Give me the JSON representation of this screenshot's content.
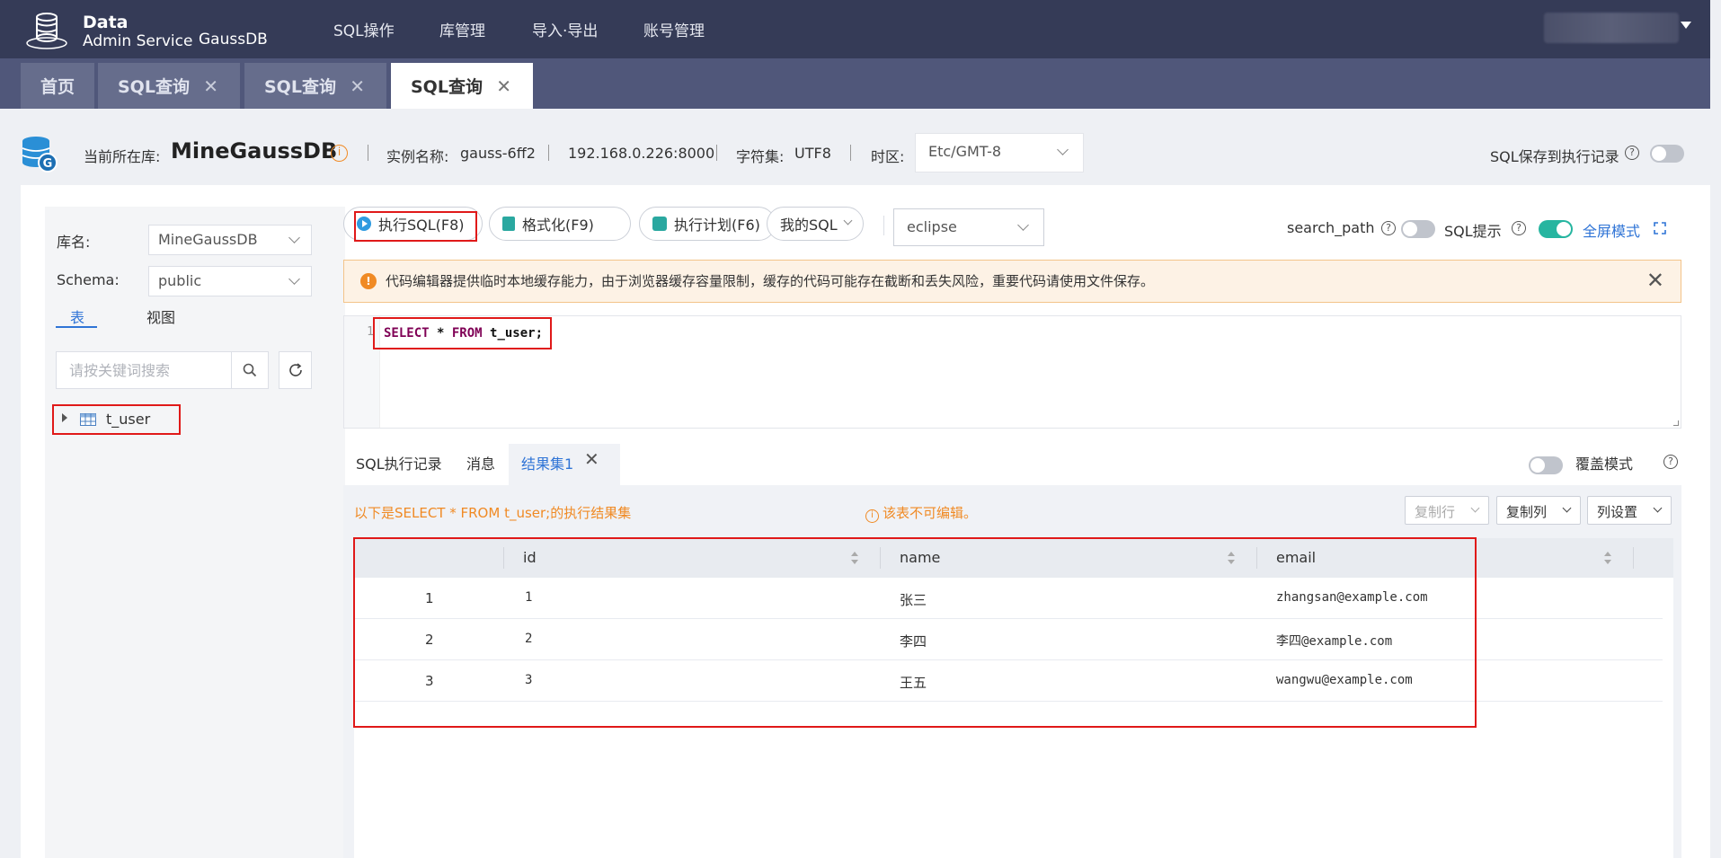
{
  "brand": {
    "line1": "Data",
    "line2": "Admin Service",
    "product": "GaussDB"
  },
  "nav": {
    "items": [
      "SQL操作",
      "库管理",
      "导入·导出",
      "账号管理"
    ]
  },
  "tabs": [
    {
      "label": "首页"
    },
    {
      "label": "SQL查询"
    },
    {
      "label": "SQL查询"
    },
    {
      "label": "SQL查询",
      "active": true
    }
  ],
  "info": {
    "current_db_label": "当前所在库:",
    "current_db": "MineGaussDB",
    "instance_label": "实例名称:",
    "instance_name": "gauss-6ff2",
    "address": "192.168.0.226:8000",
    "charset_label": "字符集:",
    "charset": "UTF8",
    "timezone_label": "时区:",
    "timezone": "Etc/GMT-8",
    "save_sql_label": "SQL保存到执行记录"
  },
  "sidebar": {
    "db_label": "库名:",
    "db_value": "MineGaussDB",
    "schema_label": "Schema:",
    "schema_value": "public",
    "tab_tables": "表",
    "tab_views": "视图",
    "search_placeholder": "请按关键词搜索",
    "tables": [
      "t_user"
    ]
  },
  "toolbar": {
    "run": "执行SQL(F8)",
    "format": "格式化(F9)",
    "plan": "执行计划(F6)",
    "my_sql": "我的SQL",
    "theme": "eclipse",
    "search_path": "search_path",
    "sql_hint": "SQL提示",
    "fullscreen": "全屏模式"
  },
  "notice": {
    "text": "代码编辑器提供临时本地缓存能力，由于浏览器缓存容量限制，缓存的代码可能存在截断和丢失风险，重要代码请使用文件保存。"
  },
  "editor": {
    "line_no": "1",
    "kw_select": "SELECT",
    "star": " * ",
    "kw_from": "FROM",
    "rest": " t_user;"
  },
  "results": {
    "tab_history": "SQL执行记录",
    "tab_messages": "消息",
    "tab_result": "结果集1",
    "overwrite_mode": "覆盖模式",
    "title": "以下是SELECT * FROM t_user;的执行结果集",
    "warning": "该表不可编辑。",
    "copy_row": "复制行",
    "copy_col": "复制列",
    "col_settings": "列设置",
    "columns": [
      "id",
      "name",
      "email"
    ],
    "rows": [
      {
        "n": "1",
        "id": "1",
        "name": "张三",
        "email": "zhangsan@example.com"
      },
      {
        "n": "2",
        "id": "2",
        "name": "李四",
        "email": "李四@example.com"
      },
      {
        "n": "3",
        "id": "3",
        "name": "王五",
        "email": "wangwu@example.com"
      }
    ]
  }
}
